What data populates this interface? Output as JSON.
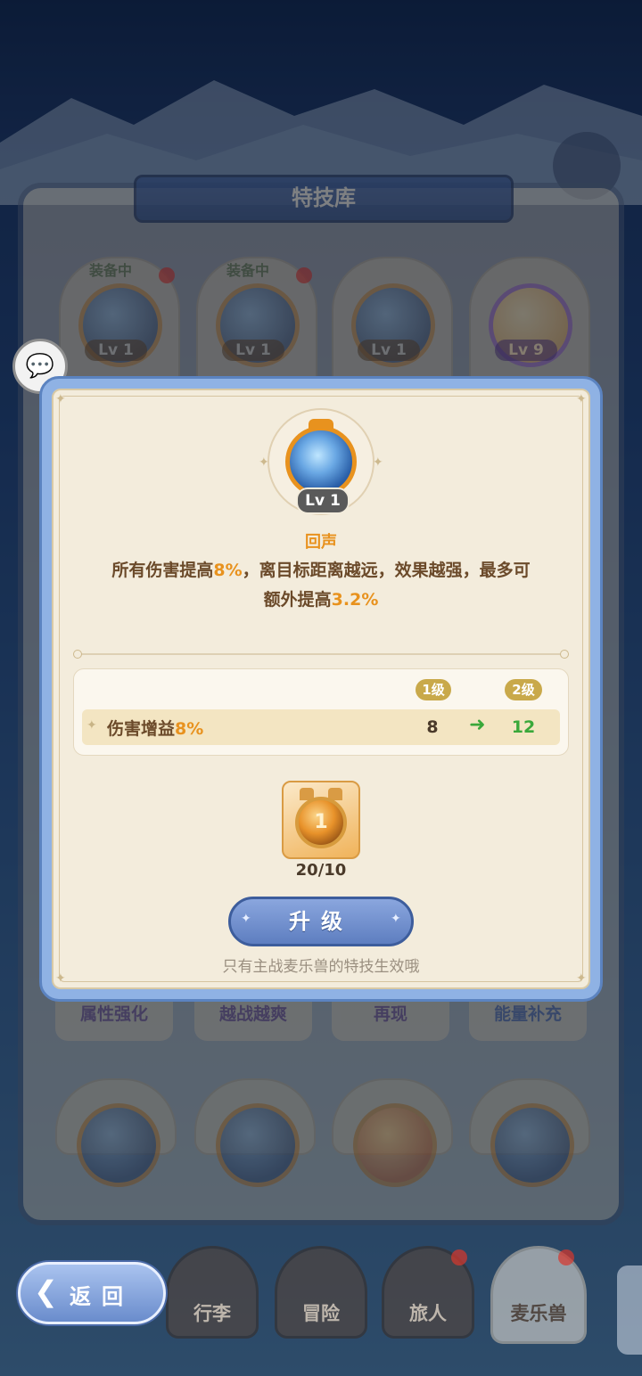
{
  "library": {
    "title": "特技库",
    "top_cards": [
      {
        "tag": "装备中",
        "level": "Lv 1"
      },
      {
        "tag": "装备中",
        "level": "Lv 1"
      },
      {
        "tag": "",
        "level": "Lv 1"
      },
      {
        "tag": "",
        "level": "Lv 9"
      }
    ],
    "name_cards": [
      "属性强化",
      "越战越爽",
      "再现",
      "能量补充"
    ]
  },
  "modal": {
    "skill_level": "Lv 1",
    "skill_name": "回声",
    "desc_line1_a": "所有伤害提高",
    "desc_line1_hl": "8%",
    "desc_line1_b": "，离目标距离越远，效果越强，最多可",
    "desc_line2_a": "额外提高",
    "desc_line2_hl": "3.2%",
    "col_current": "1级",
    "col_next": "2级",
    "stat_label": "伤害增益",
    "stat_label_hl": "8%",
    "stat_current": "8",
    "stat_next": "12",
    "material_count": "20/10",
    "material_coin": "1",
    "upgrade_label": "升级",
    "note": "只有主战麦乐兽的特技生效哦"
  },
  "nav": {
    "back_label": "返回",
    "items": [
      "行李",
      "冒险",
      "旅人",
      "麦乐兽"
    ]
  },
  "colors": {
    "accent": "#e8921e",
    "stat_up": "#3aa83a",
    "button": "#6f8ecf"
  }
}
